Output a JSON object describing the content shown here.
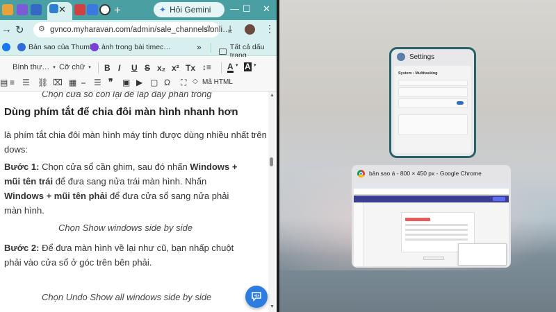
{
  "browser": {
    "new_tab": "+",
    "gemini_label": "Hỏi Gemini",
    "url": "gvnco.myharavan.com/admin/sale_channels/onli…",
    "bookmarks": [
      {
        "label": "Bản sao của Thumb…",
        "color": "#2f6bd9"
      },
      {
        "label": "ảnh trong bài timec…",
        "color": "#7b3fd6"
      }
    ],
    "bookmarks_more": "»",
    "bookmarks_folder": "Tất cả dấu trang"
  },
  "editor": {
    "font_select": "Bình thư…",
    "size_select": "Cỡ chữ",
    "buttons": [
      "B",
      "I",
      "U",
      "S",
      "x₂",
      "x²",
      "Tx"
    ],
    "html_button": "Mã HTML"
  },
  "article": {
    "caption_top": "Chọn cửa sổ còn lại để lấp đầy phần trống",
    "heading": "Dùng phím tắt để chia đôi màn hình nhanh hơn",
    "intro_line1": "là phím tắt chia đôi màn hình máy tính được dùng nhiều nhất trên",
    "intro_line2": "dows:",
    "step1_label": "Bước 1:",
    "step1_text1": " Chọn cửa sổ cần ghim, sau đó nhấn ",
    "step1_bold1": "Windows +",
    "step1_bold2": "mũi tên trái",
    "step1_text2": " để đưa sang nửa trái màn hình. Nhấn ",
    "step1_bold3": "Windows",
    "step1_bold4": "+ mũi tên phải",
    "step1_text3": " để đưa cửa sổ sang nửa phải màn hình.",
    "caption_mid": "Chọn Show windows side by side",
    "step2_label": "Bước 2:",
    "step2_text": " Để đưa màn hình về lại như cũ, bạn nhấp chuột phải vào cửa sổ ở góc trên bên phải.",
    "caption_bottom": "Chọn Undo Show all windows side by side"
  },
  "snap_assist": {
    "settings_title": "Settings",
    "settings_breadcrumb": "System  ›  Multitasking",
    "chrome_title": "bản sao á - 800 × 450 px - Google Chrome"
  },
  "colors": {
    "titlebar": "#4a9fa3",
    "toolbar": "#d8efef",
    "settings_border": "#2a6169",
    "chat_button": "#2d7de0"
  }
}
